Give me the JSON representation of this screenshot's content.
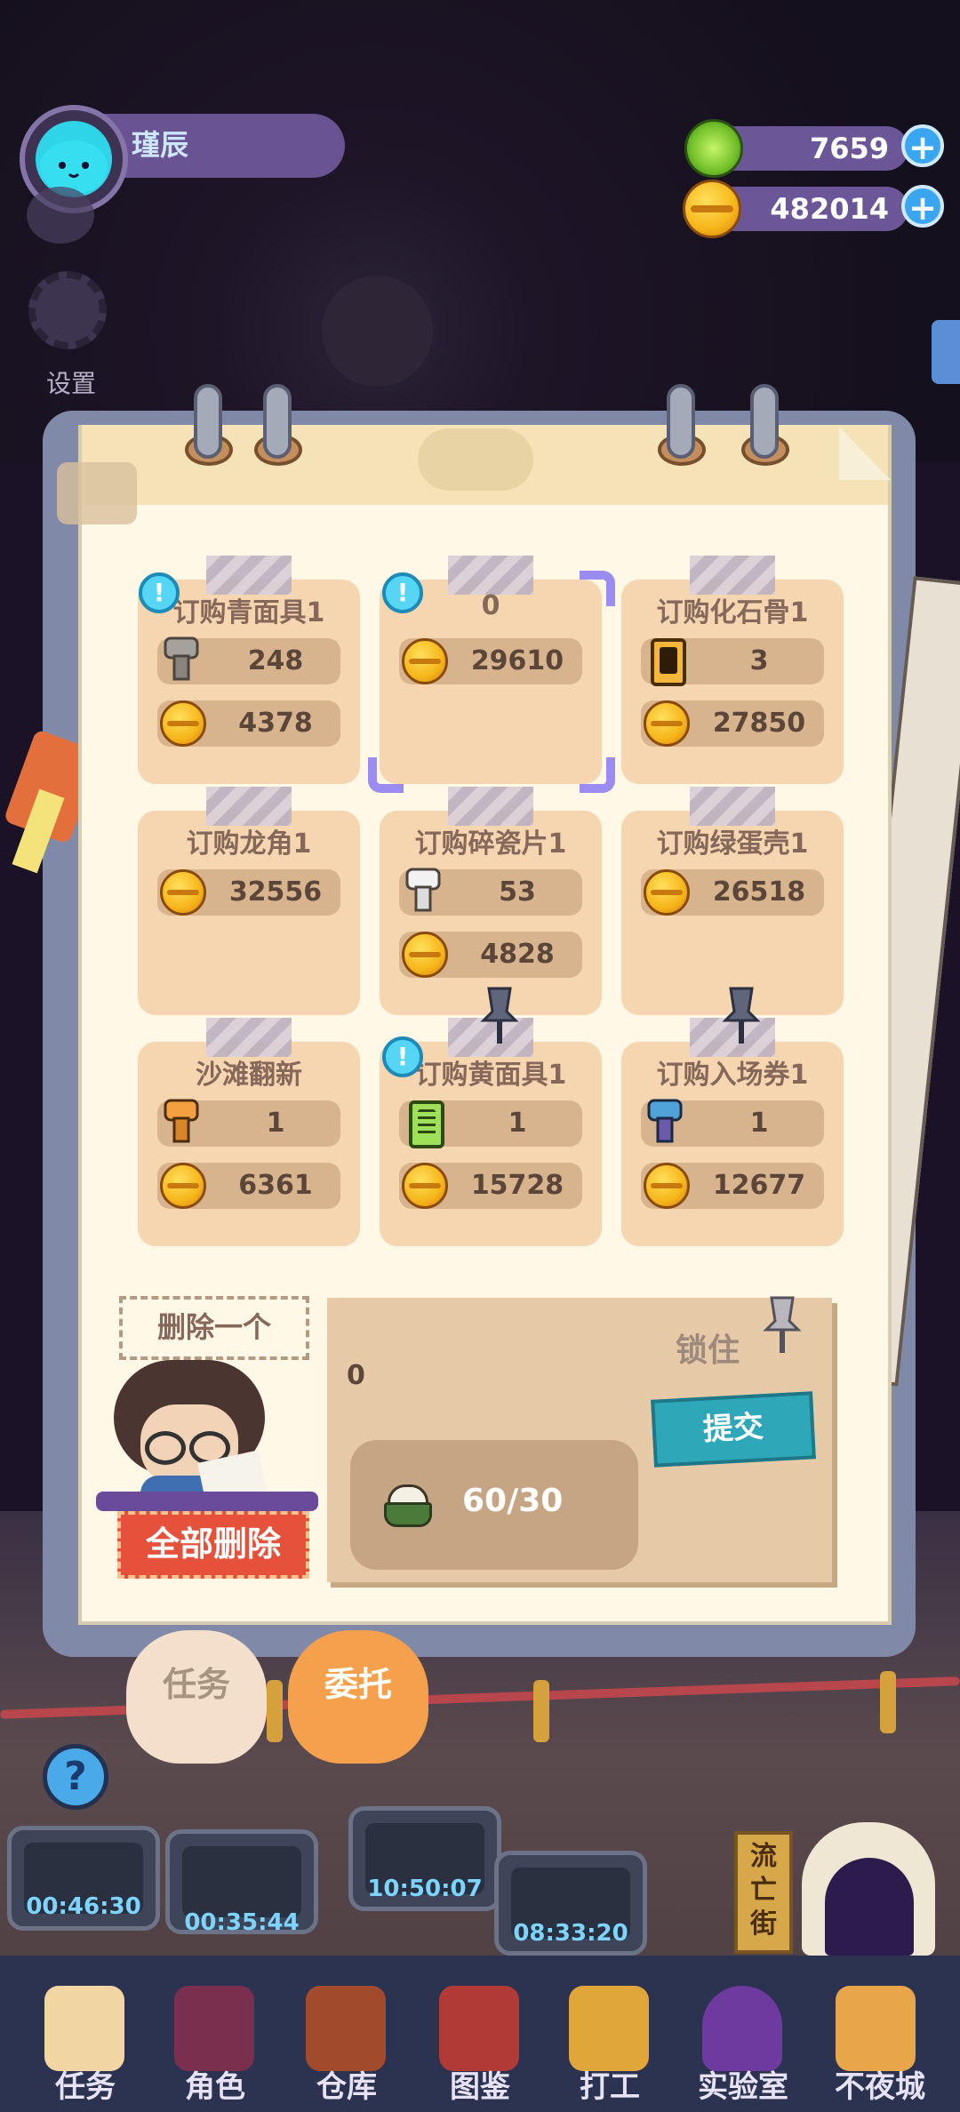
{
  "player": {
    "name": "瑾辰"
  },
  "sidebar": {
    "settings_label": "设置"
  },
  "currency": {
    "gems": "7659",
    "coins": "482014",
    "plus": "+"
  },
  "orders": [
    {
      "title": "订购青面具1",
      "alert": "!",
      "item_icon": "bolt-gray-icon",
      "item_qty": "248",
      "coin_reward": "4378"
    },
    {
      "title": "0",
      "alert": "!",
      "coin_reward": "29610",
      "selected": true
    },
    {
      "title": "订购化石骨1",
      "item_icon": "battery-orange-icon",
      "item_qty": "3",
      "coin_reward": "27850"
    },
    {
      "title": "订购龙角1",
      "coin_reward": "32556"
    },
    {
      "title": "订购碎瓷片1",
      "item_icon": "bolt-white-icon",
      "item_qty": "53",
      "coin_reward": "4828"
    },
    {
      "title": "订购绿蛋壳1",
      "coin_reward": "26518"
    },
    {
      "title": "沙滩翻新",
      "item_icon": "bolt-orange-icon",
      "item_qty": "1",
      "coin_reward": "6361"
    },
    {
      "title": "订购黄面具1",
      "alert": "!",
      "item_icon": "battery-green-icon",
      "item_qty": "1",
      "coin_reward": "15728",
      "pinned": true
    },
    {
      "title": "订购入场券1",
      "item_icon": "bolt-blue-icon",
      "item_qty": "1",
      "coin_reward": "12677",
      "pinned": true
    }
  ],
  "actions": {
    "delete_one": "删除一个",
    "delete_all": "全部删除",
    "lock": "锁住",
    "submit": "提交"
  },
  "submit_panel": {
    "order_name": "0",
    "progress_text": "60/30",
    "progress_icon": "rice-bowl-icon"
  },
  "tabs": [
    {
      "label": "任务",
      "color": "#f3dfcc",
      "text_color": "#a79480"
    },
    {
      "label": "委托",
      "color": "#f4a04c",
      "text_color": "#ffffff"
    }
  ],
  "stations": [
    {
      "timer": "00:46:30"
    },
    {
      "timer": "00:35:44"
    },
    {
      "timer": "10:50:07"
    },
    {
      "timer": "08:33:20"
    }
  ],
  "street_sign": "流亡街",
  "help": "?",
  "bottom_nav": [
    {
      "label": "任务",
      "icon": "clipboard-icon"
    },
    {
      "label": "角色",
      "icon": "character-icon"
    },
    {
      "label": "仓库",
      "icon": "chest-icon"
    },
    {
      "label": "图鉴",
      "icon": "book-icon"
    },
    {
      "label": "打工",
      "icon": "work-tv-icon"
    },
    {
      "label": "实验室",
      "icon": "lab-flask-icon"
    },
    {
      "label": "不夜城",
      "icon": "city-cat-icon"
    }
  ],
  "colors": {
    "accent_blue": "#3aa6ef",
    "delete_red": "#e5513a",
    "submit_teal": "#2ea8b9",
    "card_bg": "#f5d6b0"
  }
}
